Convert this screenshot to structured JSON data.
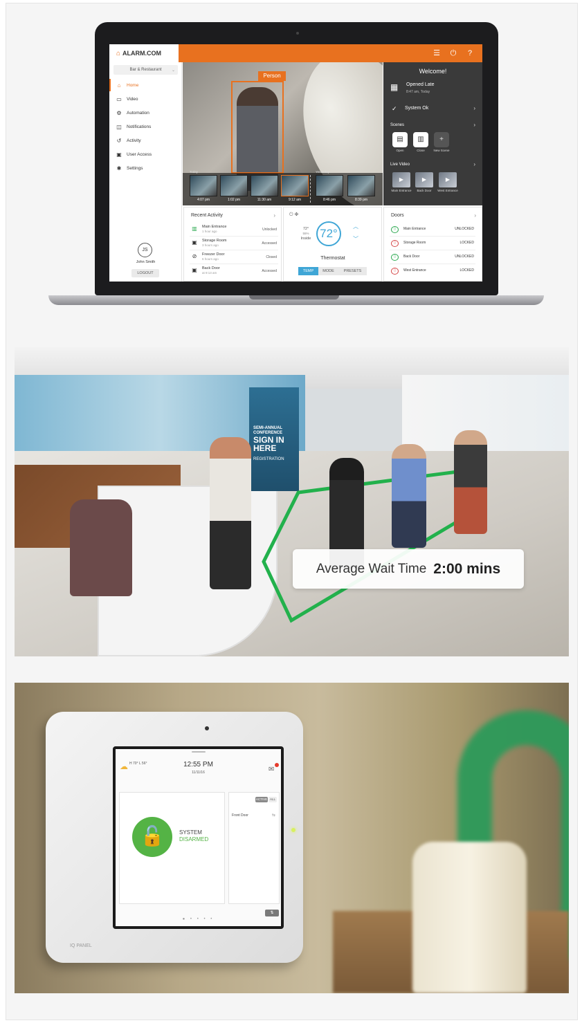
{
  "app": {
    "logo_text": "ALARM.COM",
    "location": "Bar & Restaurant",
    "nav": [
      {
        "label": "Home",
        "icon": "home-icon"
      },
      {
        "label": "Video",
        "icon": "video-icon"
      },
      {
        "label": "Automation",
        "icon": "automation-icon"
      },
      {
        "label": "Notifications",
        "icon": "notifications-icon"
      },
      {
        "label": "Activity",
        "icon": "activity-icon"
      },
      {
        "label": "User Access",
        "icon": "user-access-icon"
      },
      {
        "label": "Settings",
        "icon": "settings-icon"
      }
    ],
    "user": {
      "initials": "JS",
      "name": "John Smith",
      "logout": "LOGOUT"
    },
    "accent_color": "#e8711f"
  },
  "camera": {
    "detection_label": "Person",
    "timeline_labels": [
      "Today",
      "Yesterday"
    ],
    "thumbnails": [
      "4:07 pm",
      "1:02 pm",
      "11:30 am",
      "9:12 am",
      "8:46 pm",
      "8:39 pm"
    ]
  },
  "welcome": {
    "title": "Welcome!",
    "status_title": "Opened Late",
    "status_time": "8:47 am, Today",
    "system": "System Ok",
    "scenes_title": "Scenes",
    "scenes": [
      "Open",
      "Close",
      "New Scene"
    ],
    "live_video_title": "Live Video",
    "live_video": [
      "Main Entrance",
      "Back Door",
      "West Entrance"
    ]
  },
  "recent_activity": {
    "title": "Recent Activity",
    "items": [
      {
        "name": "Main Entrance",
        "time": "1 hour ago",
        "status": "Unlocked"
      },
      {
        "name": "Storage Room",
        "time": "3 hours ago",
        "status": "Accessed"
      },
      {
        "name": "Freezer Door",
        "time": "6 hours ago",
        "status": "Closed"
      },
      {
        "name": "Back Door",
        "time": "at 9:13 am",
        "status": "Accessed"
      }
    ]
  },
  "thermostat": {
    "setpoint": "72°",
    "inside_temp": "72°",
    "humidity": "55%",
    "inside_label": "Inside",
    "label": "Thermostat",
    "modes": [
      "TEMP",
      "MODE",
      "PRESETS"
    ],
    "active_mode": "TEMP"
  },
  "doors": {
    "title": "Doors",
    "items": [
      {
        "name": "Main Entrance",
        "status": "UNLOCKED"
      },
      {
        "name": "Storage Room",
        "status": "LOCKED"
      },
      {
        "name": "Back Door",
        "status": "UNLOCKED"
      },
      {
        "name": "West Entrance",
        "status": "LOCKED"
      }
    ]
  },
  "office": {
    "banner_small": "SEMI-ANNUAL CONFERENCE",
    "banner_main": "SIGN IN HERE",
    "banner_sub": "REGISTRATION",
    "wait_label": "Average Wait Time",
    "wait_value": "2:00 mins"
  },
  "panel": {
    "weather": "H 70° L 56°",
    "time": "12:55 PM",
    "date": "11/11/16",
    "system_line1": "SYSTEM",
    "system_line2": "DISARMED",
    "tabs": [
      "ACTIVE",
      "ALL"
    ],
    "door": "Front Door",
    "brand": "IQ PANEL"
  }
}
